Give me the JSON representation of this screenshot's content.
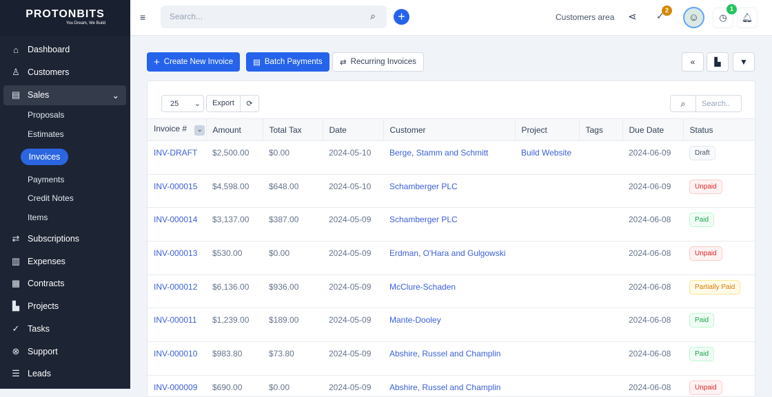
{
  "brand": {
    "name": "PROTONBITS",
    "tagline": "You Dream, We Build"
  },
  "sidebar": {
    "items": [
      {
        "label": "Dashboard",
        "icon": "home-icon"
      },
      {
        "label": "Customers",
        "icon": "user-icon"
      },
      {
        "label": "Sales",
        "icon": "document-icon"
      },
      {
        "label": "Subscriptions",
        "icon": "repeat-icon"
      },
      {
        "label": "Expenses",
        "icon": "file-icon"
      },
      {
        "label": "Contracts",
        "icon": "contract-icon"
      },
      {
        "label": "Projects",
        "icon": "chart-icon"
      },
      {
        "label": "Tasks",
        "icon": "check-circle-icon"
      },
      {
        "label": "Support",
        "icon": "lifebuoy-icon"
      },
      {
        "label": "Leads",
        "icon": "leads-icon"
      }
    ],
    "sales_sub": [
      "Proposals",
      "Estimates",
      "Invoices",
      "Payments",
      "Credit Notes",
      "Items"
    ]
  },
  "header": {
    "search_placeholder": "Search...",
    "customers_area": "Customers area",
    "tasks_badge": "2",
    "timer_badge": "1"
  },
  "toolbar": {
    "create": "Create New Invoice",
    "batch": "Batch Payments",
    "recurring": "Recurring Invoices"
  },
  "table_controls": {
    "page_size": "25",
    "export": "Export",
    "search_placeholder": "Search.."
  },
  "columns": [
    "Invoice #",
    "Amount",
    "Total Tax",
    "Date",
    "Customer",
    "Project",
    "Tags",
    "Due Date",
    "Status"
  ],
  "rows": [
    {
      "invoice": "INV-DRAFT",
      "amount": "$2,500.00",
      "tax": "$0.00",
      "date": "2024-05-10",
      "customer": "Berge, Stamm and Schmitt",
      "project": "Build Website",
      "tags": "",
      "due": "2024-06-09",
      "status": "Draft"
    },
    {
      "invoice": "INV-000015",
      "amount": "$4,598.00",
      "tax": "$648.00",
      "date": "2024-05-10",
      "customer": "Schamberger PLC",
      "project": "",
      "tags": "",
      "due": "2024-06-09",
      "status": "Unpaid"
    },
    {
      "invoice": "INV-000014",
      "amount": "$3,137.00",
      "tax": "$387.00",
      "date": "2024-05-09",
      "customer": "Schamberger PLC",
      "project": "",
      "tags": "",
      "due": "2024-06-08",
      "status": "Paid"
    },
    {
      "invoice": "INV-000013",
      "amount": "$530.00",
      "tax": "$0.00",
      "date": "2024-05-09",
      "customer": "Erdman, O'Hara and Gulgowski",
      "project": "",
      "tags": "",
      "due": "2024-06-08",
      "status": "Unpaid"
    },
    {
      "invoice": "INV-000012",
      "amount": "$6,136.00",
      "tax": "$936.00",
      "date": "2024-05-09",
      "customer": "McClure-Schaden",
      "project": "",
      "tags": "",
      "due": "2024-06-08",
      "status": "Partially Paid"
    },
    {
      "invoice": "INV-000011",
      "amount": "$1,239.00",
      "tax": "$189.00",
      "date": "2024-05-09",
      "customer": "Mante-Dooley",
      "project": "",
      "tags": "",
      "due": "2024-06-08",
      "status": "Paid"
    },
    {
      "invoice": "INV-000010",
      "amount": "$983.80",
      "tax": "$73.80",
      "date": "2024-05-09",
      "customer": "Abshire, Russel and Champlin",
      "project": "",
      "tags": "",
      "due": "2024-06-08",
      "status": "Paid"
    },
    {
      "invoice": "INV-000009",
      "amount": "$690.00",
      "tax": "$0.00",
      "date": "2024-05-09",
      "customer": "Abshire, Russel and Champlin",
      "project": "",
      "tags": "",
      "due": "2024-06-08",
      "status": "Unpaid"
    }
  ],
  "status_colors": {
    "Draft": "#475569",
    "Unpaid": "#dc2626",
    "Paid": "#16a34a",
    "Partially Paid": "#d97706"
  }
}
